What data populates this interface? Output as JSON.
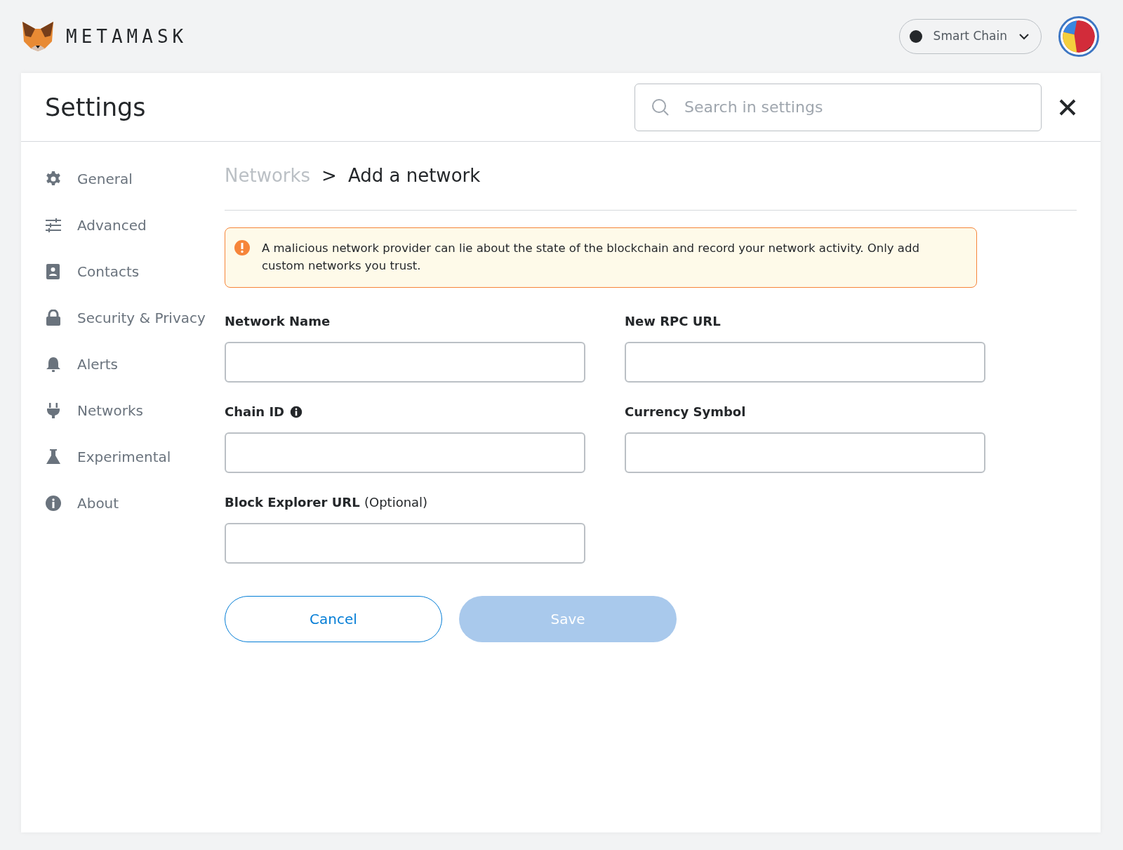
{
  "app": {
    "logo_text": "METAMASK",
    "network": {
      "label": "Smart Chain"
    }
  },
  "settings": {
    "title": "Settings",
    "search": {
      "placeholder": "Search in settings"
    }
  },
  "sidebar": {
    "items": [
      {
        "label": "General"
      },
      {
        "label": "Advanced"
      },
      {
        "label": "Contacts"
      },
      {
        "label": "Security & Privacy"
      },
      {
        "label": "Alerts"
      },
      {
        "label": "Networks"
      },
      {
        "label": "Experimental"
      },
      {
        "label": "About"
      }
    ]
  },
  "breadcrumb": {
    "parent": "Networks",
    "separator": ">",
    "current": "Add a network"
  },
  "warning": "A malicious network provider can lie about the state of the blockchain and record your network activity. Only add custom networks you trust.",
  "fields": [
    {
      "label": "Network Name",
      "info": false
    },
    {
      "label": "New RPC URL",
      "info": false
    },
    {
      "label": "Chain ID",
      "info": true
    },
    {
      "label": "Currency Symbol",
      "info": false
    },
    {
      "label": "Block Explorer URL",
      "note": "(Optional)",
      "info": false
    }
  ],
  "buttons": [
    {
      "label": "Cancel",
      "kind": "secondary",
      "disabled": false
    },
    {
      "label": "Save",
      "kind": "primary",
      "disabled": true
    }
  ]
}
